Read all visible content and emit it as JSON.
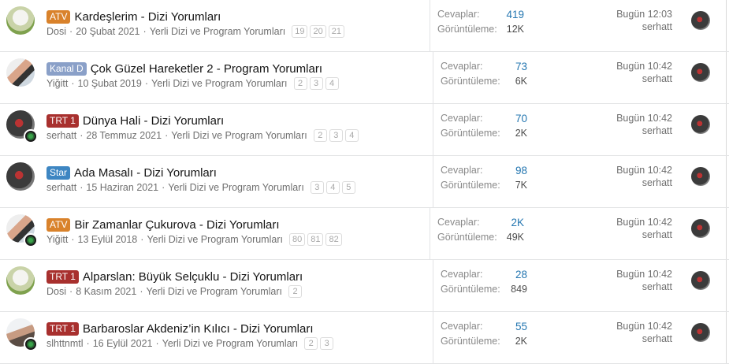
{
  "threads": [
    {
      "prefix": "ATV",
      "prefix_color": "#d9822b",
      "title": "Kardeşlerim - Dizi Yorumları",
      "author": "Dosi",
      "date": "20 Şubat 2021",
      "forum": "Yerli Dizi ve Program Yorumları",
      "pages": [
        "19",
        "20",
        "21"
      ],
      "replies_label": "Cevaplar:",
      "replies": "419",
      "views_label": "Görüntüleme:",
      "views": "12K",
      "last_date": "Bugün 12:03",
      "last_user": "serhatt",
      "avatar": "cat",
      "has_badge": false
    },
    {
      "prefix": "Kanal D",
      "prefix_color": "#8aa0c8",
      "title": "Çok Güzel Hareketler 2 - Program Yorumları",
      "author": "Yiğitt",
      "date": "10 Şubat 2019",
      "forum": "Yerli Dizi ve Program Yorumları",
      "pages": [
        "2",
        "3",
        "4"
      ],
      "replies_label": "Cevaplar:",
      "replies": "73",
      "views_label": "Görüntüleme:",
      "views": "6K",
      "last_date": "Bugün 10:42",
      "last_user": "serhatt",
      "avatar": "couple",
      "has_badge": false
    },
    {
      "prefix": "TRT 1",
      "prefix_color": "#a8302e",
      "title": "Dünya Hali - Dizi Yorumları",
      "author": "serhatt",
      "date": "28 Temmuz 2021",
      "forum": "Yerli Dizi ve Program Yorumları",
      "pages": [
        "2",
        "3",
        "4"
      ],
      "replies_label": "Cevaplar:",
      "replies": "70",
      "views_label": "Görüntüleme:",
      "views": "2K",
      "last_date": "Bugün 10:42",
      "last_user": "serhatt",
      "avatar": "selfie",
      "has_badge": true
    },
    {
      "prefix": "Star",
      "prefix_color": "#3e86c2",
      "title": "Ada Masalı - Dizi Yorumları",
      "author": "serhatt",
      "date": "15 Haziran 2021",
      "forum": "Yerli Dizi ve Program Yorumları",
      "pages": [
        "3",
        "4",
        "5"
      ],
      "replies_label": "Cevaplar:",
      "replies": "98",
      "views_label": "Görüntüleme:",
      "views": "7K",
      "last_date": "Bugün 10:42",
      "last_user": "serhatt",
      "avatar": "selfie",
      "has_badge": false
    },
    {
      "prefix": "ATV",
      "prefix_color": "#d9822b",
      "title": "Bir Zamanlar Çukurova - Dizi Yorumları",
      "author": "Yiğitt",
      "date": "13 Eylül 2018",
      "forum": "Yerli Dizi ve Program Yorumları",
      "pages": [
        "80",
        "81",
        "82"
      ],
      "replies_label": "Cevaplar:",
      "replies": "2K",
      "views_label": "Görüntüleme:",
      "views": "49K",
      "last_date": "Bugün 10:42",
      "last_user": "serhatt",
      "avatar": "couple",
      "has_badge": true
    },
    {
      "prefix": "TRT 1",
      "prefix_color": "#a8302e",
      "title": "Alparslan: Büyük Selçuklu - Dizi Yorumları",
      "author": "Dosi",
      "date": "8 Kasım 2021",
      "forum": "Yerli Dizi ve Program Yorumları",
      "pages": [
        "2"
      ],
      "replies_label": "Cevaplar:",
      "replies": "28",
      "views_label": "Görüntüleme:",
      "views": "849",
      "last_date": "Bugün 10:42",
      "last_user": "serhatt",
      "avatar": "cat",
      "has_badge": false
    },
    {
      "prefix": "TRT 1",
      "prefix_color": "#a8302e",
      "title": "Barbaroslar Akdeniz’in Kılıcı - Dizi Yorumları",
      "author": "slhttnmtl",
      "date": "16 Eylül 2021",
      "forum": "Yerli Dizi ve Program Yorumları",
      "pages": [
        "2",
        "3"
      ],
      "replies_label": "Cevaplar:",
      "replies": "55",
      "views_label": "Görüntüleme:",
      "views": "2K",
      "last_date": "Bugün 10:42",
      "last_user": "serhatt",
      "avatar": "man",
      "has_badge": true
    }
  ]
}
